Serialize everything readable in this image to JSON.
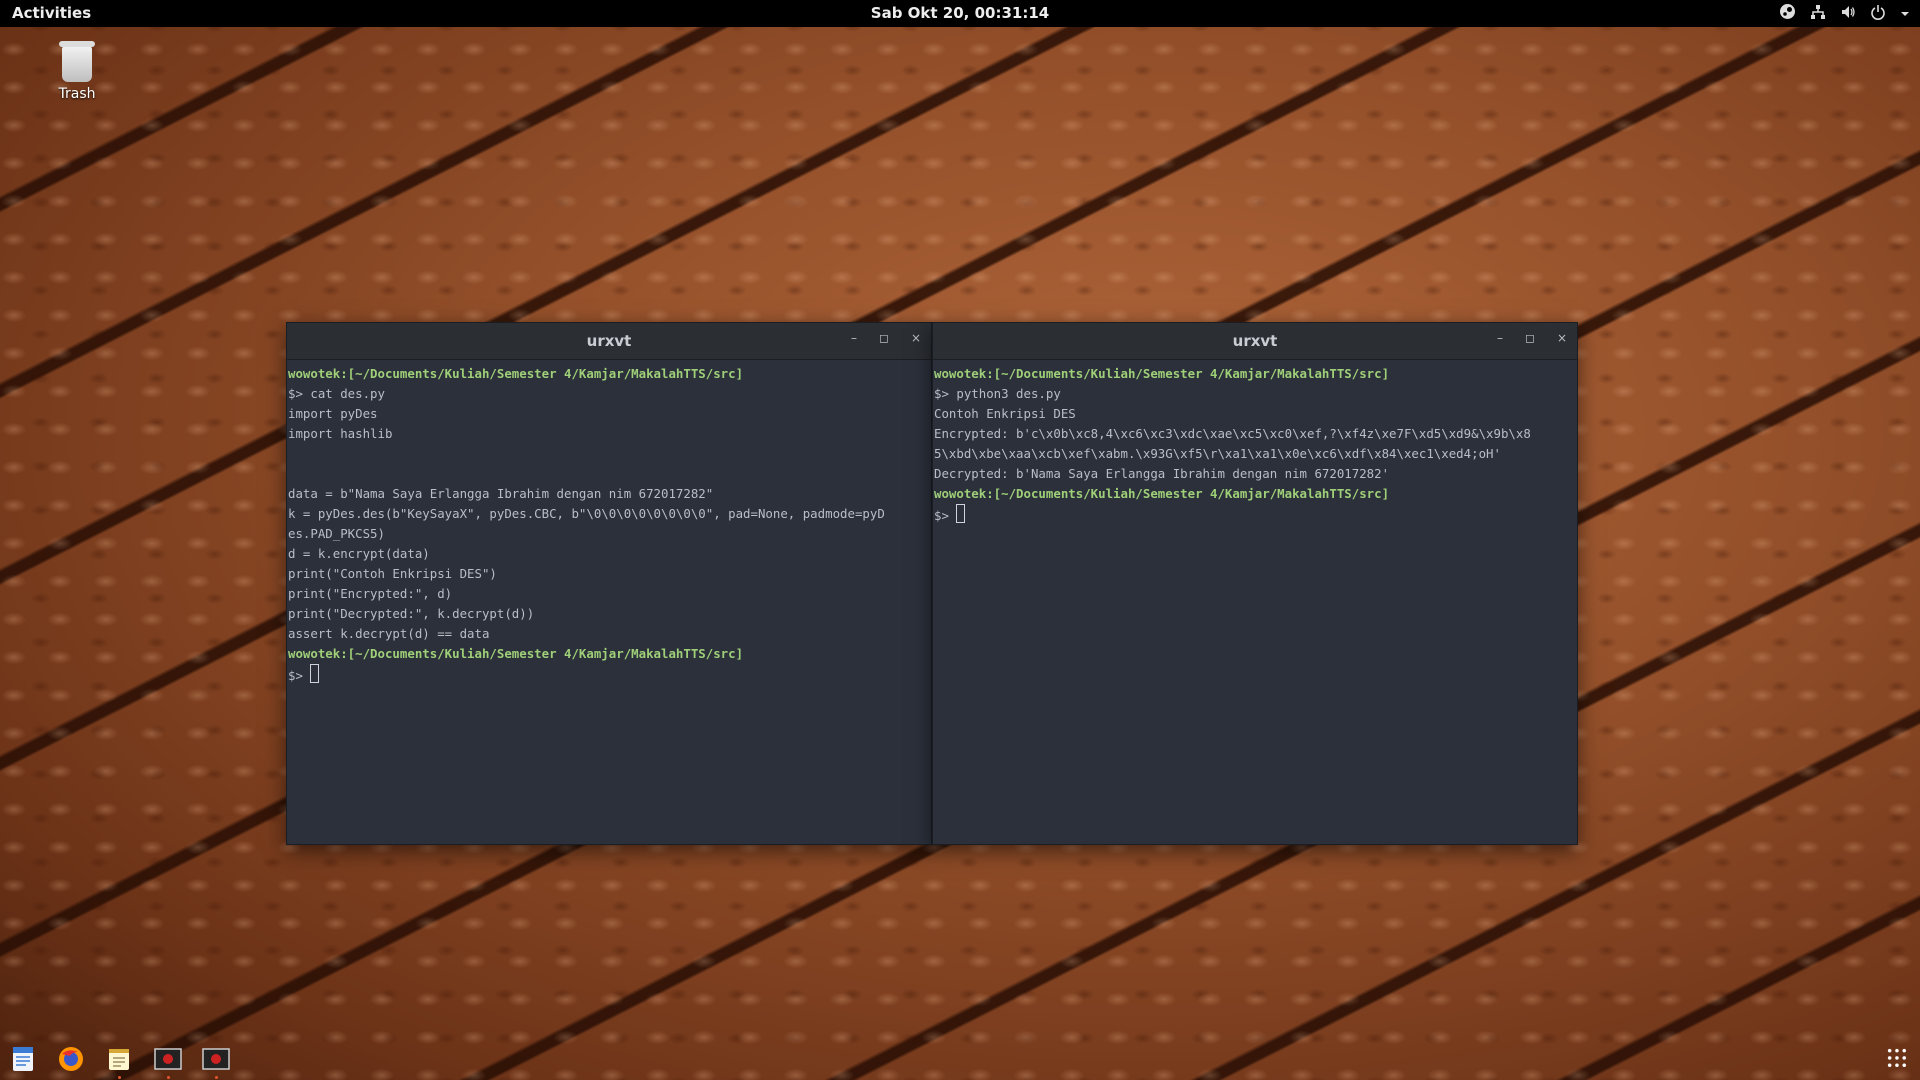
{
  "topbar": {
    "activities": "Activities",
    "clock": "Sab Okt 20, 00:31:14",
    "tray_icons": [
      "steam-icon",
      "network-icon",
      "volume-icon",
      "power-icon",
      "chevron-down-icon"
    ]
  },
  "desktop": {
    "trash_label": "Trash"
  },
  "windows": [
    {
      "title": "urxvt",
      "lines": [
        {
          "prompt": "wowotek:[~/Documents/Kuliah/Semester 4/Kamjar/MakalahTTS/src]",
          "text": ""
        },
        {
          "prompt": "",
          "text": "$> cat des.py"
        },
        {
          "prompt": "",
          "text": "import pyDes"
        },
        {
          "prompt": "",
          "text": "import hashlib"
        },
        {
          "prompt": "",
          "text": ""
        },
        {
          "prompt": "",
          "text": ""
        },
        {
          "prompt": "",
          "text": "data = b\"Nama Saya Erlangga Ibrahim dengan nim 672017282\""
        },
        {
          "prompt": "",
          "text": "k = pyDes.des(b\"KeySayaX\", pyDes.CBC, b\"\\0\\0\\0\\0\\0\\0\\0\\0\", pad=None, padmode=pyD"
        },
        {
          "prompt": "",
          "text": "es.PAD_PKCS5)"
        },
        {
          "prompt": "",
          "text": "d = k.encrypt(data)"
        },
        {
          "prompt": "",
          "text": "print(\"Contoh Enkripsi DES\")"
        },
        {
          "prompt": "",
          "text": "print(\"Encrypted:\", d)"
        },
        {
          "prompt": "",
          "text": "print(\"Decrypted:\", k.decrypt(d))"
        },
        {
          "prompt": "",
          "text": "assert k.decrypt(d) == data"
        },
        {
          "prompt": "wowotek:[~/Documents/Kuliah/Semester 4/Kamjar/MakalahTTS/src]",
          "text": ""
        }
      ],
      "input_prompt": "$> "
    },
    {
      "title": "urxvt",
      "lines": [
        {
          "prompt": "wowotek:[~/Documents/Kuliah/Semester 4/Kamjar/MakalahTTS/src]",
          "text": ""
        },
        {
          "prompt": "",
          "text": "$> python3 des.py"
        },
        {
          "prompt": "",
          "text": "Contoh Enkripsi DES"
        },
        {
          "prompt": "",
          "text": "Encrypted: b'c\\x0b\\xc8,4\\xc6\\xc3\\xdc\\xae\\xc5\\xc0\\xef,?\\xf4z\\xe7F\\xd5\\xd9&\\x9b\\x8"
        },
        {
          "prompt": "",
          "text": "5\\xbd\\xbe\\xaa\\xcb\\xef\\xabm.\\x93G\\xf5\\r\\xa1\\xa1\\x0e\\xc6\\xdf\\x84\\xec1\\xed4;oH'"
        },
        {
          "prompt": "",
          "text": "Decrypted: b'Nama Saya Erlangga Ibrahim dengan nim 672017282'"
        },
        {
          "prompt": "wowotek:[~/Documents/Kuliah/Semester 4/Kamjar/MakalahTTS/src]",
          "text": ""
        }
      ],
      "input_prompt": "$> "
    }
  ],
  "window_controls": {
    "minimize": "–",
    "maximize": "◻",
    "close": "×"
  },
  "dock": {
    "items": [
      "text-editor-icon",
      "firefox-icon",
      "notes-icon",
      "terminal-icon",
      "terminal-icon"
    ],
    "apps_grid": "show-applications-icon"
  },
  "colors": {
    "topbar_bg": "#000000",
    "terminal_bg": "#2b303b",
    "prompt_green": "#9fcf78",
    "terminal_text": "#b9bec6"
  }
}
